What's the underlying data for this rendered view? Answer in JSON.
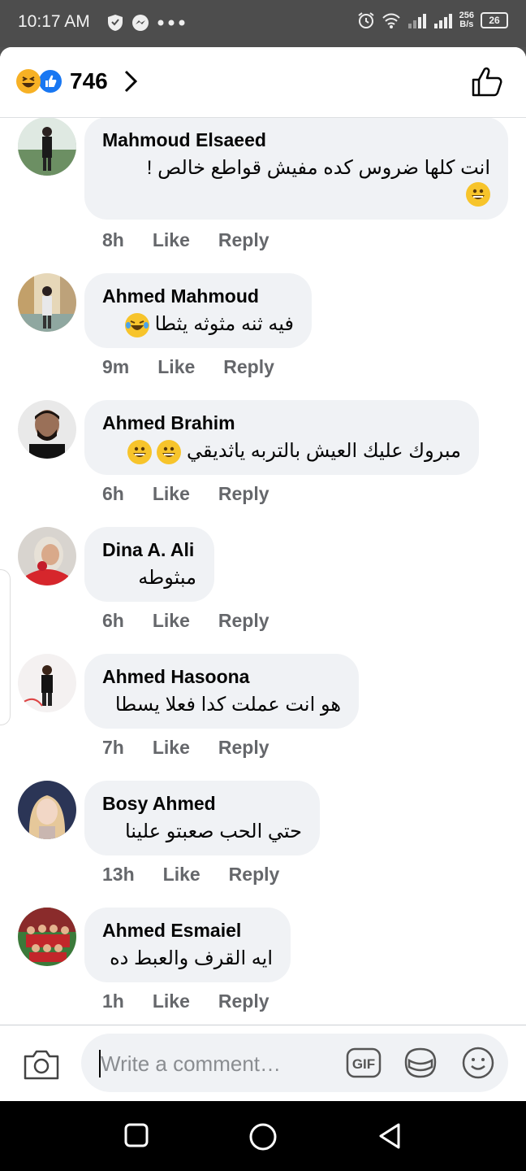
{
  "status_bar": {
    "time": "10:17 AM",
    "net_speed_value": "256",
    "net_speed_unit": "B/s",
    "battery": "26"
  },
  "header": {
    "reaction_count": "746",
    "reactions": [
      "haha-icon",
      "like-icon"
    ]
  },
  "comments": [
    {
      "name": "Mahmoud Elsaeed",
      "text": "انت كلها ضروس كده مفيش قواطع خالص !",
      "emoji": "grinning-face-icon",
      "time": "8h",
      "like": "Like",
      "reply": "Reply"
    },
    {
      "name": "Ahmed Mahmoud",
      "text": "فيه ثنه مثوثه يثطا",
      "emoji": "tears-of-joy-icon",
      "time": "9m",
      "like": "Like",
      "reply": "Reply"
    },
    {
      "name": "Ahmed Brahim",
      "text": "مبروك عليك العيش بالتربه ياثديقي",
      "emoji": "grinning-face-icon",
      "time": "6h",
      "like": "Like",
      "reply": "Reply"
    },
    {
      "name": "Dina A. Ali",
      "text": "مبثوطه",
      "time": "6h",
      "like": "Like",
      "reply": "Reply"
    },
    {
      "name": "Ahmed Hasoona",
      "text": "هو انت عملت كدا فعلا يسطا",
      "time": "7h",
      "like": "Like",
      "reply": "Reply"
    },
    {
      "name": "Bosy Ahmed",
      "text": "حتي الحب صعبتو علينا",
      "time": "13h",
      "like": "Like",
      "reply": "Reply"
    },
    {
      "name": "Ahmed Esmaiel",
      "text": "ايه القرف والعبط ده",
      "time": "1h",
      "like": "Like",
      "reply": "Reply"
    }
  ],
  "composer": {
    "placeholder": "Write a comment…",
    "gif_label": "GIF"
  },
  "colors": {
    "accent": "#1877f2",
    "bubble": "#f0f2f5",
    "meta": "#65676b"
  }
}
